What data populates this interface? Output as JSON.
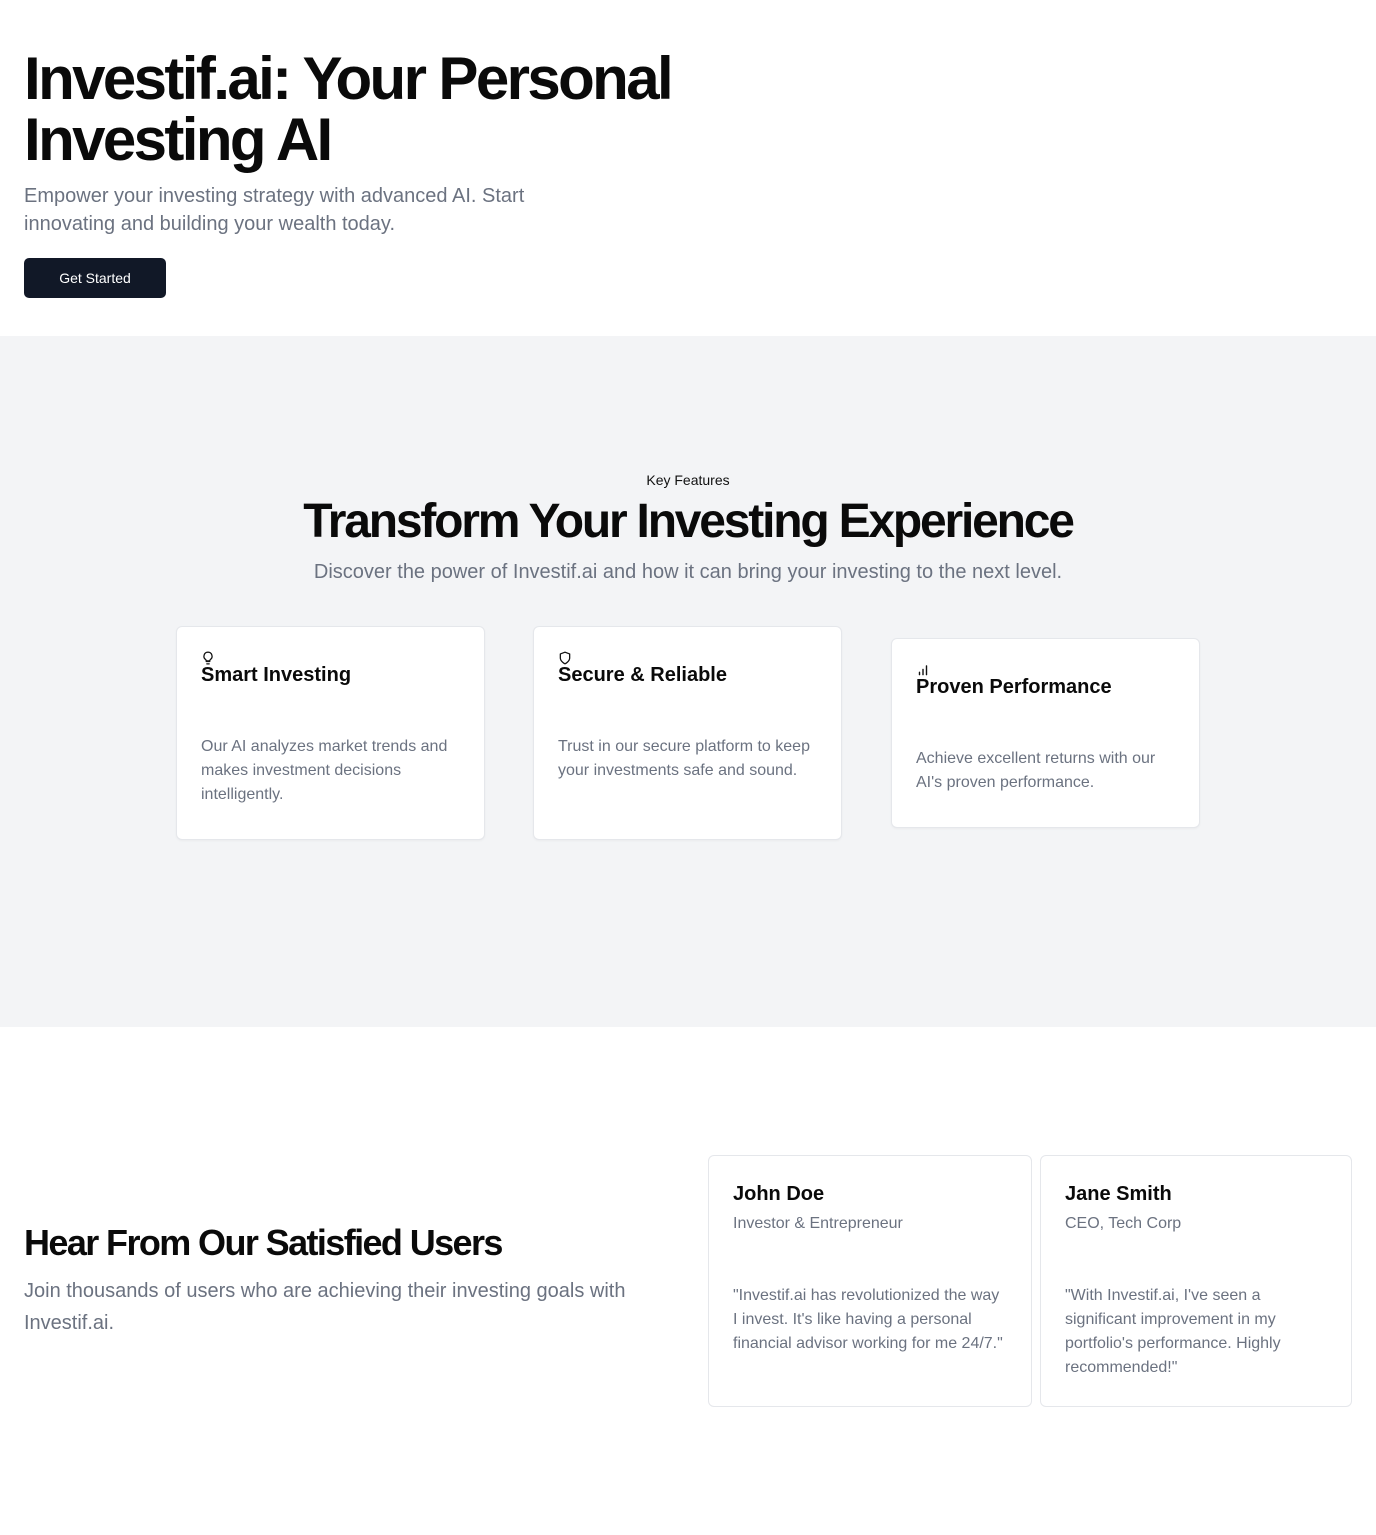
{
  "hero": {
    "title": "Investif.ai: Your Personal Investing AI",
    "subtitle": "Empower your investing strategy with advanced AI. Start innovating and building your wealth today.",
    "cta_label": "Get Started"
  },
  "features": {
    "eyebrow": "Key Features",
    "title": "Transform Your Investing Experience",
    "lead": "Discover the power of Investif.ai and how it can bring your investing to the next level.",
    "items": [
      {
        "icon": "lightbulb-icon",
        "title": "Smart Investing",
        "text": "Our AI analyzes market trends and makes investment decisions intelligently."
      },
      {
        "icon": "shield-icon",
        "title": "Secure & Reliable",
        "text": "Trust in our secure platform to keep your investments safe and sound."
      },
      {
        "icon": "bar-chart-icon",
        "title": "Proven Performance",
        "text": "Achieve excellent returns with our AI's proven performance."
      }
    ]
  },
  "testimonials": {
    "title": "Hear From Our Satisfied Users",
    "lead": "Join thousands of users who are achieving their investing goals with Investif.ai.",
    "items": [
      {
        "name": "John Doe",
        "role": "Investor & Entrepreneur",
        "quote": "\"Investif.ai has revolutionized the way I invest. It's like having a personal financial advisor working for me 24/7.\""
      },
      {
        "name": "Jane Smith",
        "role": "CEO, Tech Corp",
        "quote": "\"With Investif.ai, I've seen a significant improvement in my portfolio's performance. Highly recommended!\""
      }
    ]
  },
  "colors": {
    "primary_button": "#111827",
    "muted_text": "#6b7280",
    "section_bg": "#f3f4f6",
    "border": "#e5e7eb"
  }
}
